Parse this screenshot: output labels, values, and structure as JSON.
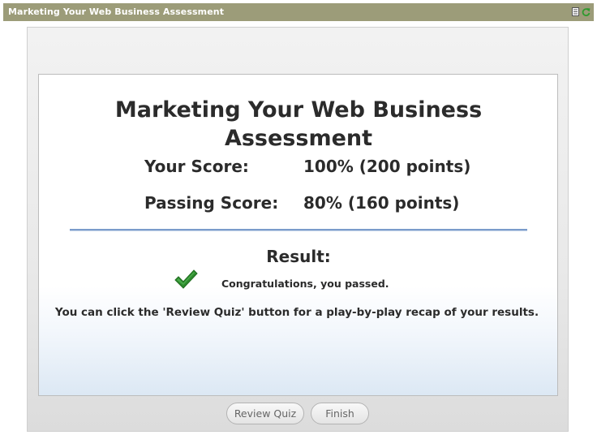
{
  "window": {
    "title": "Marketing Your Web Business Assessment"
  },
  "assessment": {
    "title_line1": "Marketing Your Web Business",
    "title_line2": "Assessment",
    "your_score_label": "Your Score:",
    "your_score_value": "100% (200 points)",
    "passing_score_label": "Passing Score:",
    "passing_score_value": "80% (160 points)",
    "result_label": "Result:",
    "result_message": "Congratulations, you passed.",
    "recap_text": "You can click the 'Review Quiz' button for a play-by-play recap of your results."
  },
  "buttons": {
    "review": "Review Quiz",
    "finish": "Finish"
  },
  "colors": {
    "titlebar": "#9c9c79",
    "divider": "#7b9ccb",
    "check": "#2e8b2e"
  }
}
